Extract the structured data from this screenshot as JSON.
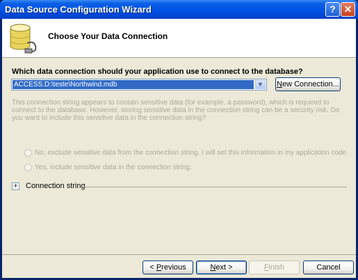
{
  "window": {
    "title": "Data Source Configuration Wizard",
    "help_glyph": "?",
    "close_glyph": "✕"
  },
  "header": {
    "title": "Choose Your Data Connection",
    "icon": "database-plug-icon"
  },
  "main": {
    "question": "Which data connection should your application use to connect to the database?",
    "connection_combo": {
      "selected": "ACCESS.D:\\teste\\Northwind.mdb",
      "arrow_glyph": "▼"
    },
    "new_connection_label_pre": "",
    "new_connection_label_ul": "N",
    "new_connection_label_post": "ew Connection...",
    "sensitive_info_text": "This connection string appears to contain sensitive data (for example, a password), which is required to connect to the database. However, storing sensitive data in the connection string can be a security risk. Do you want to include this sensitive data in the connection string?",
    "radio_no_label": "No, exclude sensitive data from the connection string. I will set this information in my application code.",
    "radio_yes_label": "Yes, include sensitive data in the connection string.",
    "connection_string_expander": "+",
    "connection_string_label": "Connection string"
  },
  "footer": {
    "previous": {
      "pre": "< ",
      "ul": "P",
      "post": "revious"
    },
    "next": {
      "pre": "",
      "ul": "N",
      "post": "ext >"
    },
    "finish": {
      "pre": "",
      "ul": "F",
      "post": "inish"
    },
    "cancel": "Cancel"
  },
  "colors": {
    "titlebar": "#0055e5",
    "selection": "#316ac5",
    "dialog_bg": "#ece9d8",
    "disabled_text": "#aca899"
  }
}
